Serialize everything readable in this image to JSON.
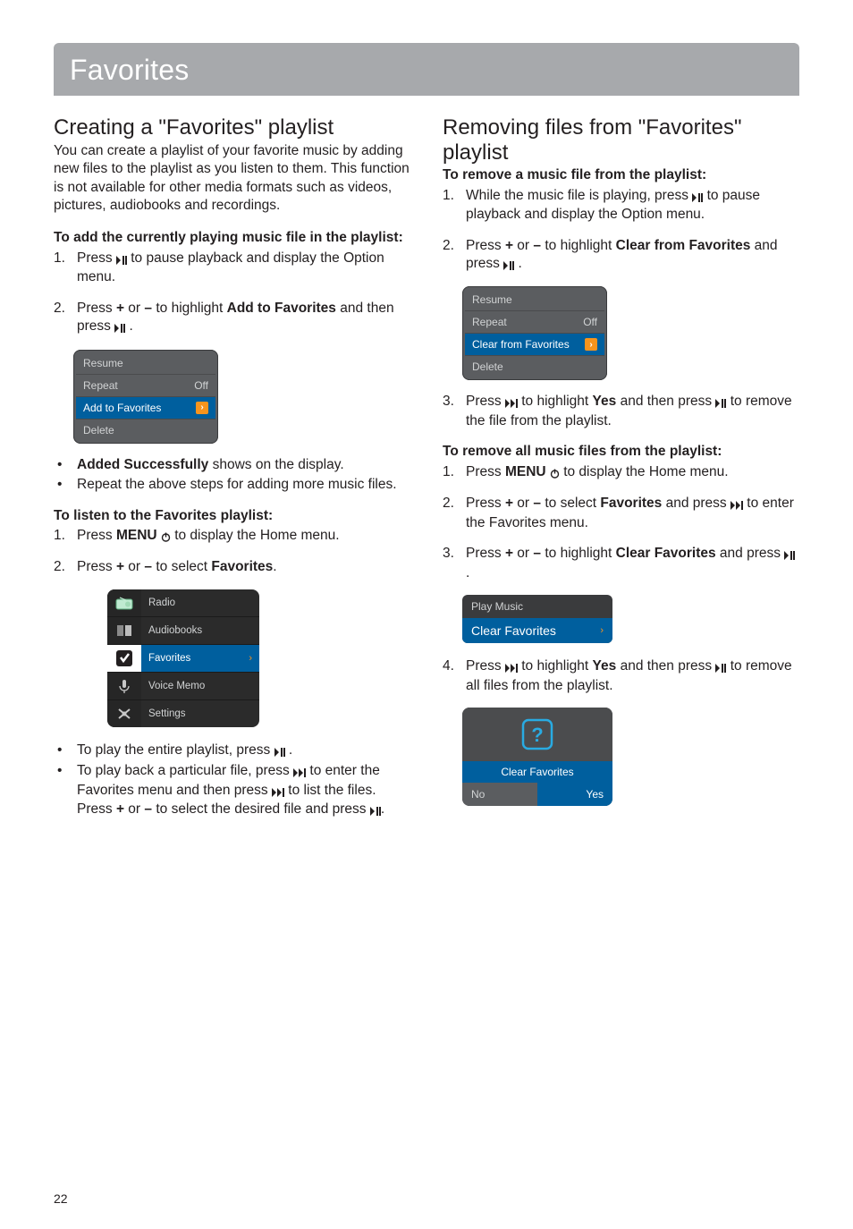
{
  "page_number": "22",
  "title": "Favorites",
  "left": {
    "h2": "Creating a \"Favorites\" playlist",
    "intro": "You can create a playlist of your favorite music by adding new files to the playlist as you listen to them. This function is not available for other media formats such as videos, pictures, audiobooks and recordings.",
    "sub1": "To add the currently playing music file in the playlist:",
    "step1_num": "1.",
    "step1_a": "Press ",
    "step1_b": " to pause playback and display the Option menu.",
    "step2_num": "2.",
    "step2_a": "Press ",
    "step2_plus": "+",
    "step2_or": " or ",
    "step2_minus": "–",
    "step2_b": " to highlight ",
    "step2_bold": "Add to Favorites",
    "step2_c": " and then press ",
    "step2_d": " .",
    "menu1": {
      "r1": "Resume",
      "r2": "Repeat",
      "r2v": "Off",
      "r3": "Add to Favorites",
      "r4": "Delete"
    },
    "bul1_bold": "Added Successfully",
    "bul1_rest": " shows on the display.",
    "bul2": "Repeat the above steps for adding more music files.",
    "sub2": "To listen to the Favorites playlist:",
    "listen1_num": "1.",
    "listen1_a": "Press ",
    "listen1_menu": "MENU",
    "listen1_b": " to display the Home menu.",
    "listen2_num": "2.",
    "listen2_a": "Press ",
    "listen2_plus": "+",
    "listen2_or": " or ",
    "listen2_minus": "–",
    "listen2_b": " to select ",
    "listen2_bold": "Favorites",
    "listen2_c": ".",
    "home": {
      "r1": "Radio",
      "r2": "Audiobooks",
      "r3": "Favorites",
      "r4": "Voice Memo",
      "r5": "Settings"
    },
    "tail1_a": "To play the entire playlist, press ",
    "tail1_b": " .",
    "tail2_a": "To play back a particular file, press ",
    "tail2_b": " to enter the Favorites menu and then press ",
    "tail2_c": " to list the files. Press ",
    "tail2_plus": "+",
    "tail2_or": " or ",
    "tail2_minus": "–",
    "tail2_d": " to select the desired file and press ",
    "tail2_e": "."
  },
  "right": {
    "h2": "Removing files from \"Favorites\" playlist",
    "sub1": "To remove a music file from the playlist:",
    "r1_num": "1.",
    "r1_a": "While the music file is playing, press ",
    "r1_b": " to pause playback and display the Option menu.",
    "r2_num": "2.",
    "r2_a": "Press ",
    "r2_plus": "+",
    "r2_or": " or ",
    "r2_minus": "–",
    "r2_b": " to highlight ",
    "r2_bold": "Clear from Favorites",
    "r2_c": " and press ",
    "r2_d": " .",
    "menu2": {
      "r1": "Resume",
      "r2": "Repeat",
      "r2v": "Off",
      "r3": "Clear from Favorites",
      "r4": "Delete"
    },
    "r3_num": "3.",
    "r3_a": "Press ",
    "r3_b": " to highlight ",
    "r3_bold": "Yes",
    "r3_c": " and then press ",
    "r3_d": " to remove the file from the playlist.",
    "sub2": "To remove all music files from the playlist:",
    "a1_num": "1.",
    "a1_a": "Press ",
    "a1_menu": "MENU",
    "a1_b": " to display the Home menu.",
    "a2_num": "2.",
    "a2_a": "Press ",
    "a2_plus": "+",
    "a2_or": " or ",
    "a2_minus": "–",
    "a2_b": " to select ",
    "a2_bold": "Favorites",
    "a2_c": " and press ",
    "a2_d": " to enter the Favorites menu.",
    "a3_num": "3.",
    "a3_a": "Press ",
    "a3_plus": "+",
    "a3_or": " or ",
    "a3_minus": "–",
    "a3_b": " to highlight ",
    "a3_bold": "Clear Favorites",
    "a3_c": " and press ",
    "a3_d": " .",
    "menu3": {
      "r1": "Play Music",
      "r2": "Clear Favorites"
    },
    "a4_num": "4.",
    "a4_a": "Press ",
    "a4_b": " to highlight ",
    "a4_bold": "Yes",
    "a4_c": " and then press ",
    "a4_d": " to remove all files from the playlist.",
    "confirm": {
      "title": "Clear Favorites",
      "no": "No",
      "yes": "Yes"
    }
  }
}
